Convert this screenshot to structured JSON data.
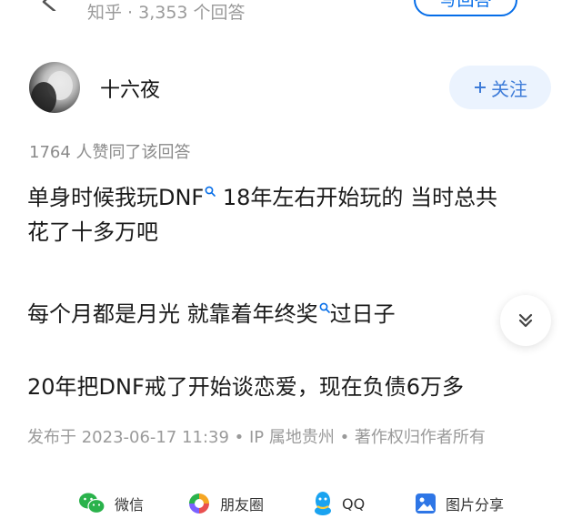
{
  "topbar": {
    "source_label": "知乎 · 3,353 个回答",
    "write_answer_label": "写回答"
  },
  "author": {
    "name": "十六夜",
    "follow_label": "关注"
  },
  "answer": {
    "likes_text": "1764 人赞同了该回答",
    "paragraphs": {
      "p1_a": "单身时候我玩",
      "p1_kw": "DNF",
      "p1_b": " 18年左右开始玩的 当时总共",
      "p1_line2": "花了十多万吧",
      "p2_a": "每个月都是月光 就靠着",
      "p2_kw": "年终奖",
      "p2_b": "过日子",
      "p3": "20年把DNF戒了开始谈恋爱，现在负债6万多"
    },
    "publish_info": "发布于 2023-06-17 11:39 • IP 属地贵州 • 著作权归作者所有"
  },
  "share": {
    "wechat": "微信",
    "moments": "朋友圈",
    "qq": "QQ",
    "image_share": "图片分享"
  },
  "colors": {
    "accent": "#056de8",
    "follow_bg": "#ebf3fe",
    "muted_text": "#9a9a9a",
    "wechat_green": "#2ab24b",
    "qq_blue": "#1aa3f0"
  }
}
